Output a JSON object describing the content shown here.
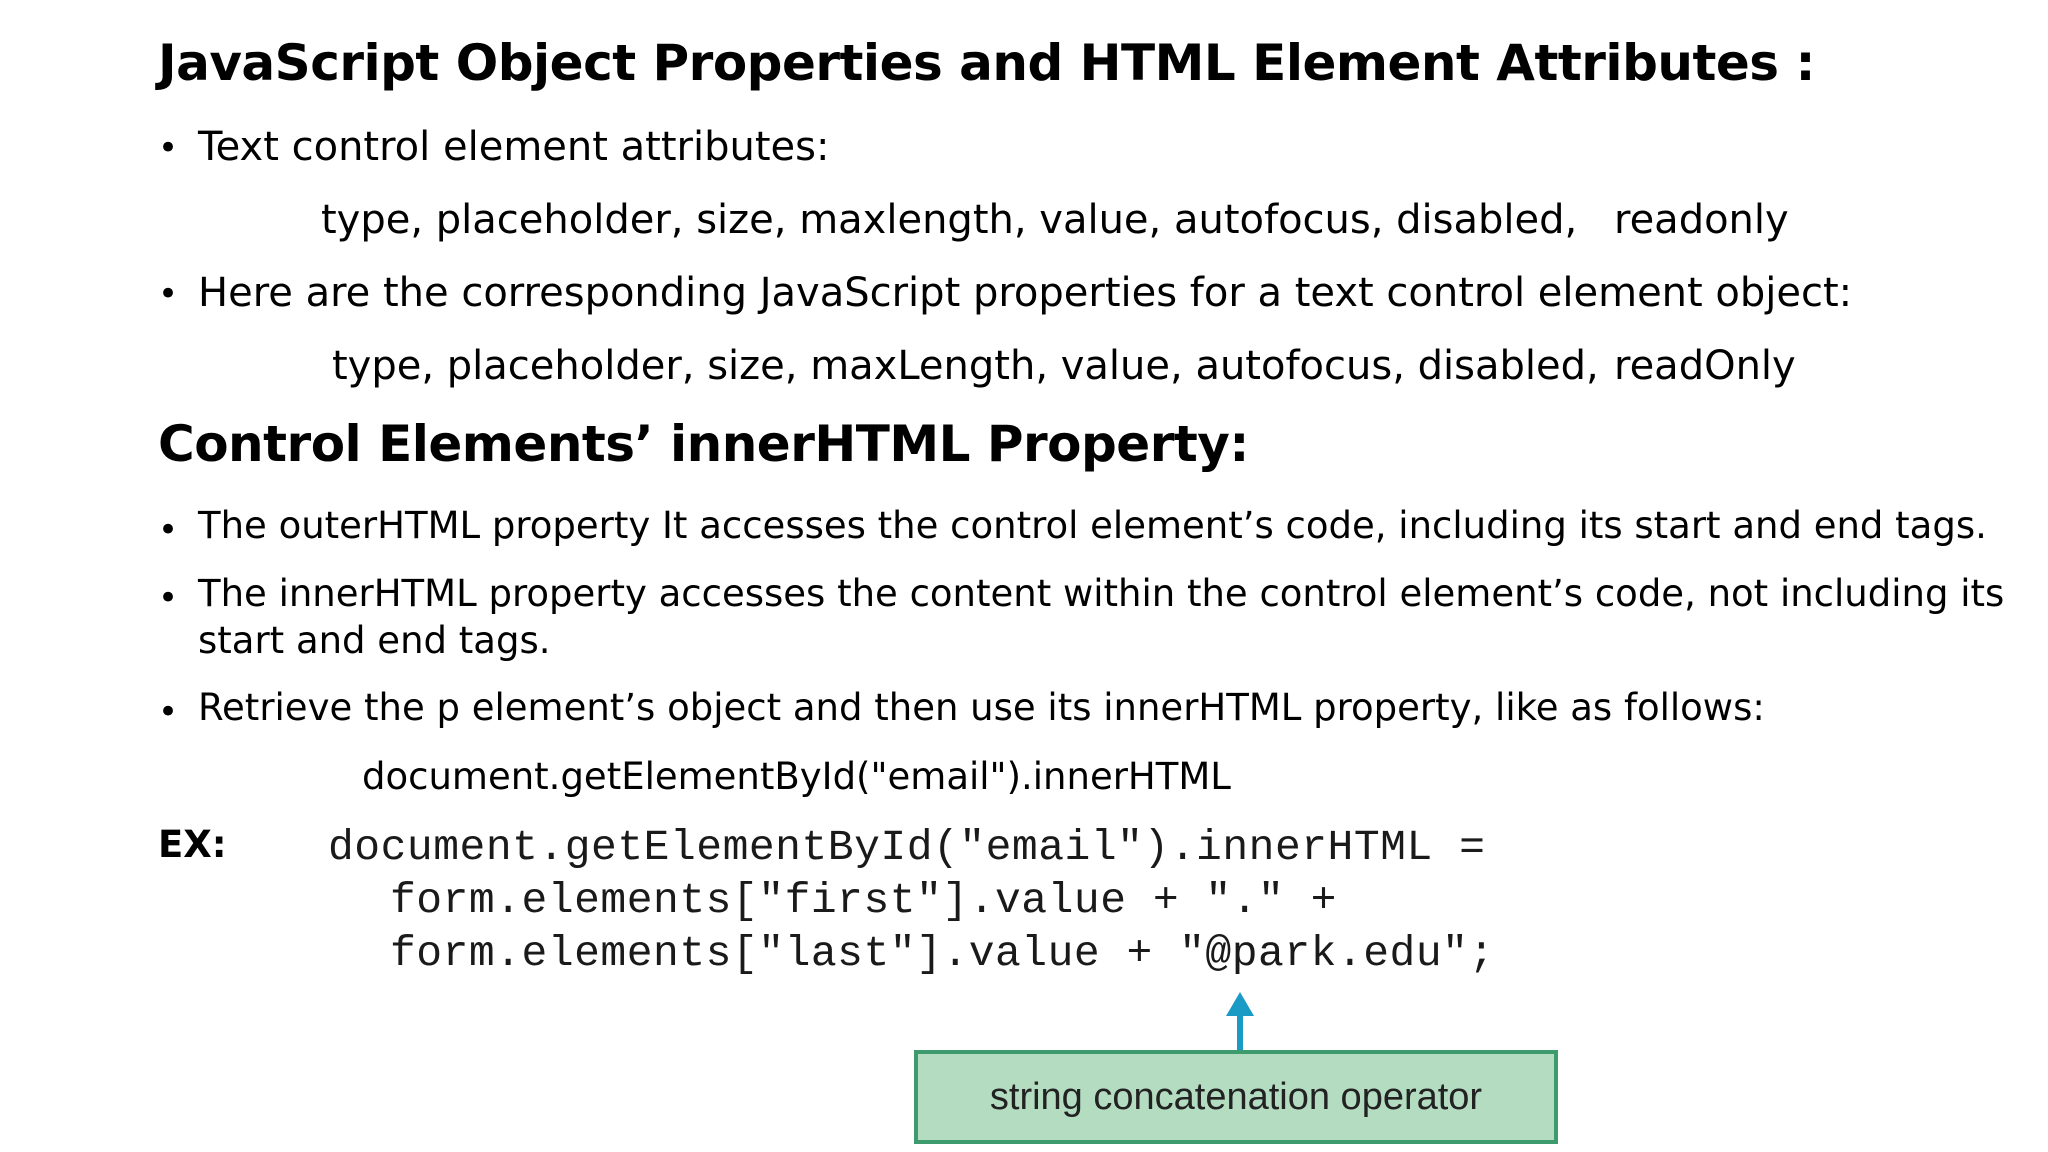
{
  "heading1": "JavaScript Object Properties and HTML Element Attributes :",
  "section1": {
    "bullet1": "Text control element attributes:",
    "attributes_line": "type, placeholder, size, maxlength, value, autofocus, disabled,",
    "attributes_last": "readonly",
    "bullet2": "Here are the corresponding JavaScript properties for a text control element object:",
    "properties_line": "type, placeholder, size, maxLength, value, autofocus, disabled,",
    "properties_last": "readOnly"
  },
  "heading2": "Control Elements’ innerHTML Property:",
  "section2": {
    "bullet1": "The outerHTML property It accesses the control element’s code, including its start and end tags.",
    "bullet2_line1": "The innerHTML property accesses the content within the control element’s code, not including its",
    "bullet2_line2": "start and end tags.",
    "bullet3": "Retrieve the p element’s object and then use its innerHTML property, like as follows:",
    "example_line": "document.getElementById(\"email\").innerHTML"
  },
  "example": {
    "label": "EX:",
    "code_line1": "document.getElementById(\"email\").innerHTML =",
    "code_line2": "form.elements[\"first\"].value + \".\" +",
    "code_line3": "form.elements[\"last\"].value + \"@park.edu\";",
    "callout_label": "string concatenation operator",
    "callout_fill": "#b3dcc1",
    "callout_border": "#3e9b6d",
    "arrow_color": "#1a9bc6"
  },
  "bullet_glyph": "•"
}
